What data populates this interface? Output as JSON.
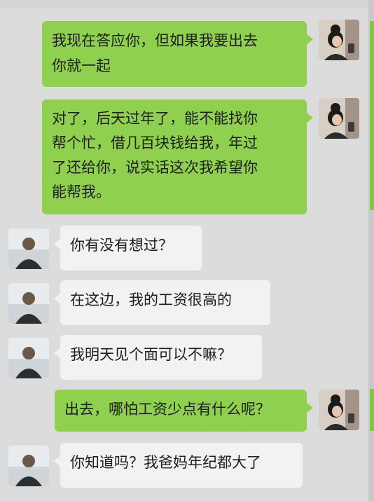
{
  "colors": {
    "background": "#dcdcdc",
    "self_bubble": "#8fd14f",
    "other_bubble": "#f2f2f2",
    "text": "#1e1e1e"
  },
  "messages": [
    {
      "from": "self",
      "text": "我现在答应你，但如果我要出去\n你就一起"
    },
    {
      "from": "self",
      "text": "对了，后天过年了，能不能找你\n帮个忙，借几百块钱给我，年过\n了还给你，说实话这次我希望你\n能帮我。"
    },
    {
      "from": "other",
      "text": "你有没有想过？"
    },
    {
      "from": "other",
      "text": "在这边，我的工资很高的"
    },
    {
      "from": "other",
      "text": "我明天见个面可以不嘛？"
    },
    {
      "from": "self",
      "text": "出去，哪怕工资少点有什么呢？"
    },
    {
      "from": "other",
      "text": "你知道吗？我爸妈年纪都大了"
    }
  ]
}
